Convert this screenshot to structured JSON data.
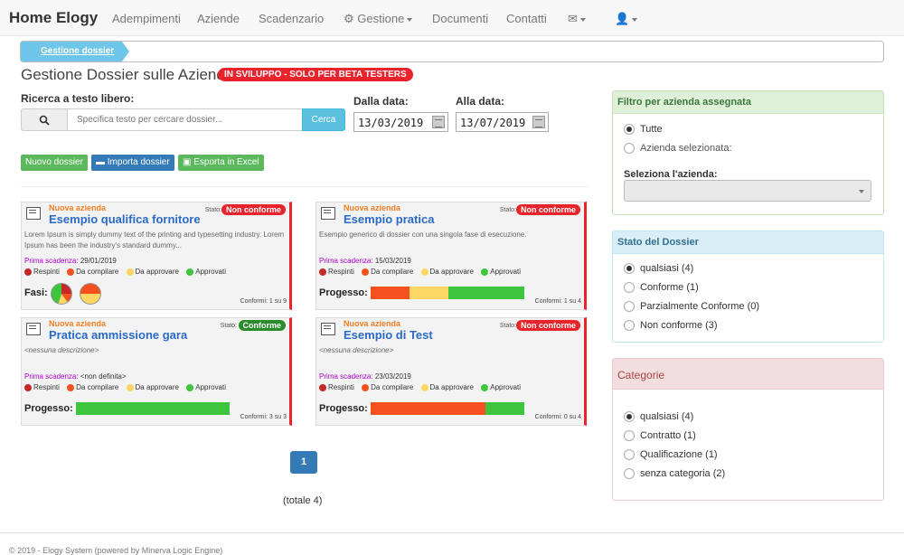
{
  "navbar": {
    "brand": "Home Elogy",
    "items": [
      "Adempimenti",
      "Aziende",
      "Scadenzario",
      "Gestione",
      "Documenti",
      "Contatti"
    ]
  },
  "breadcrumb": {
    "current": "Gestione dossier"
  },
  "page": {
    "title": "Gestione Dossier sulle Aziende",
    "beta_badge": "IN SVILUPPO - SOLO PER BETA TESTERS"
  },
  "search": {
    "label": "Ricerca a testo libero:",
    "placeholder": "Specifica testo per cercare dossier...",
    "button": "Cerca"
  },
  "dates": {
    "from_label": "Dalla data:",
    "from_value": "13/03/2019",
    "to_label": "Alla data:",
    "to_value": "13/07/2019"
  },
  "actions": {
    "new": "Nuovo dossier",
    "import": "Importa dossier",
    "export": "Esporta in Excel"
  },
  "legend": [
    "Respinti",
    "Da compilare",
    "Da approvare",
    "Approvati"
  ],
  "colors": {
    "respinti": "#c62828",
    "da_compilare": "#f4511e",
    "da_approvare": "#fdd663",
    "approvati": "#3dc63d"
  },
  "cards": [
    {
      "tag": "Nuova azienda",
      "title": "Esempio qualifica fornitore",
      "stato_label": "Stato:",
      "stato": "Non conforme",
      "description": "Lorem Ipsum is simply dummy text of the printing and typesetting industry. Lorem Ipsum has been the industry's standard dummy...",
      "prima_label": "Prima scadenza:",
      "prima_value": "29/01/2019",
      "progress_label": "Fasi:",
      "conformi": "Conformi: 1 su 9"
    },
    {
      "tag": "Nuova azienda",
      "title": "Esempio pratica",
      "stato_label": "Stato:",
      "stato": "Non conforme",
      "description": "Esempio generico di dossier con una singola fase di esecuzione.",
      "prima_label": "Prima scadenza:",
      "prima_value": "15/03/2019",
      "progress_label": "Progesso:",
      "progress": {
        "da_compilare": 0.25,
        "da_approvare": 0.25,
        "approvati": 0.5
      },
      "conformi": "Conformi: 1 su 4"
    },
    {
      "tag": "Nuova azienda",
      "title": "Pratica ammissione gara",
      "stato_label": "Stato:",
      "stato": "Conforme",
      "description": "<nessuna descrizione>",
      "prima_label": "Prima scadenza:",
      "prima_value": "<non definita>",
      "progress_label": "Progesso:",
      "progress": {
        "approvati": 1.0
      },
      "conformi": "Conformi: 3 su 3"
    },
    {
      "tag": "Nuova azienda",
      "title": "Esempio di Test",
      "stato_label": "Stato:",
      "stato": "Non conforme",
      "description": "<nessuna descrizione>",
      "prima_label": "Prima scadenza:",
      "prima_value": "23/03/2019",
      "progress_label": "Progesso:",
      "progress": {
        "da_compilare": 0.75,
        "approvati": 0.25
      },
      "conformi": "Conformi: 0 su 4"
    }
  ],
  "pagination": {
    "page": "1",
    "totale": "(totale 4)"
  },
  "footer": "© 2019 - Elogy System (powered by Minerva Logic Engine)",
  "filtro_azienda": {
    "title": "Filtro per azienda assegnata",
    "options": [
      "Tutte",
      "Azienda selezionata:"
    ],
    "select_label": "Seleziona l'azienda:"
  },
  "stato_dossier": {
    "title": "Stato del Dossier",
    "options": [
      "qualsiasi (4)",
      "Conforme (1)",
      "Parzialmente Conforme (0)",
      "Non conforme (3)"
    ]
  },
  "categorie": {
    "title": "Categorie",
    "options": [
      "qualsiasi (4)",
      "Contratto (1)",
      "Qualificazione (1)",
      "senza categoria (2)"
    ]
  }
}
